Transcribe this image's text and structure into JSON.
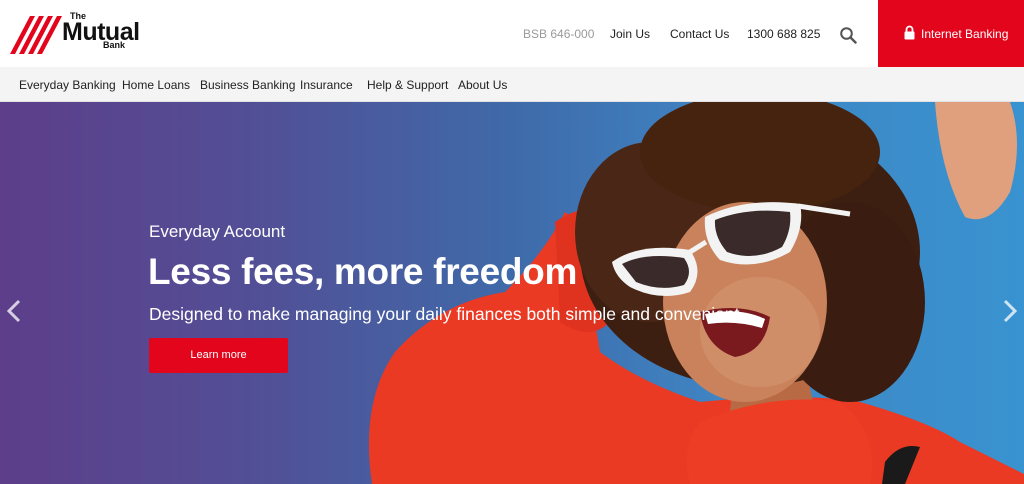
{
  "brand": {
    "the": "The",
    "name": "Mutual",
    "sub": "Bank",
    "color": "#e3051b"
  },
  "header": {
    "bsb": "BSB 646-000",
    "join": "Join Us",
    "contact": "Contact Us",
    "phone": "1300 688 825",
    "search_icon": "search-icon",
    "internet_banking": "Internet Banking",
    "internet_banking_icon": "lock-icon"
  },
  "nav": {
    "items": [
      {
        "label": "Everyday Banking"
      },
      {
        "label": "Home Loans"
      },
      {
        "label": "Business Banking"
      },
      {
        "label": "Insurance"
      },
      {
        "label": "Help & Support"
      },
      {
        "label": "About Us"
      }
    ]
  },
  "hero": {
    "eyebrow": "Everyday Account",
    "title": "Less fees, more freedom",
    "subtitle": "Designed to make managing your daily finances both simple and convenient",
    "cta": "Learn more",
    "prev_icon": "chevron-left-icon",
    "next_icon": "chevron-right-icon"
  }
}
